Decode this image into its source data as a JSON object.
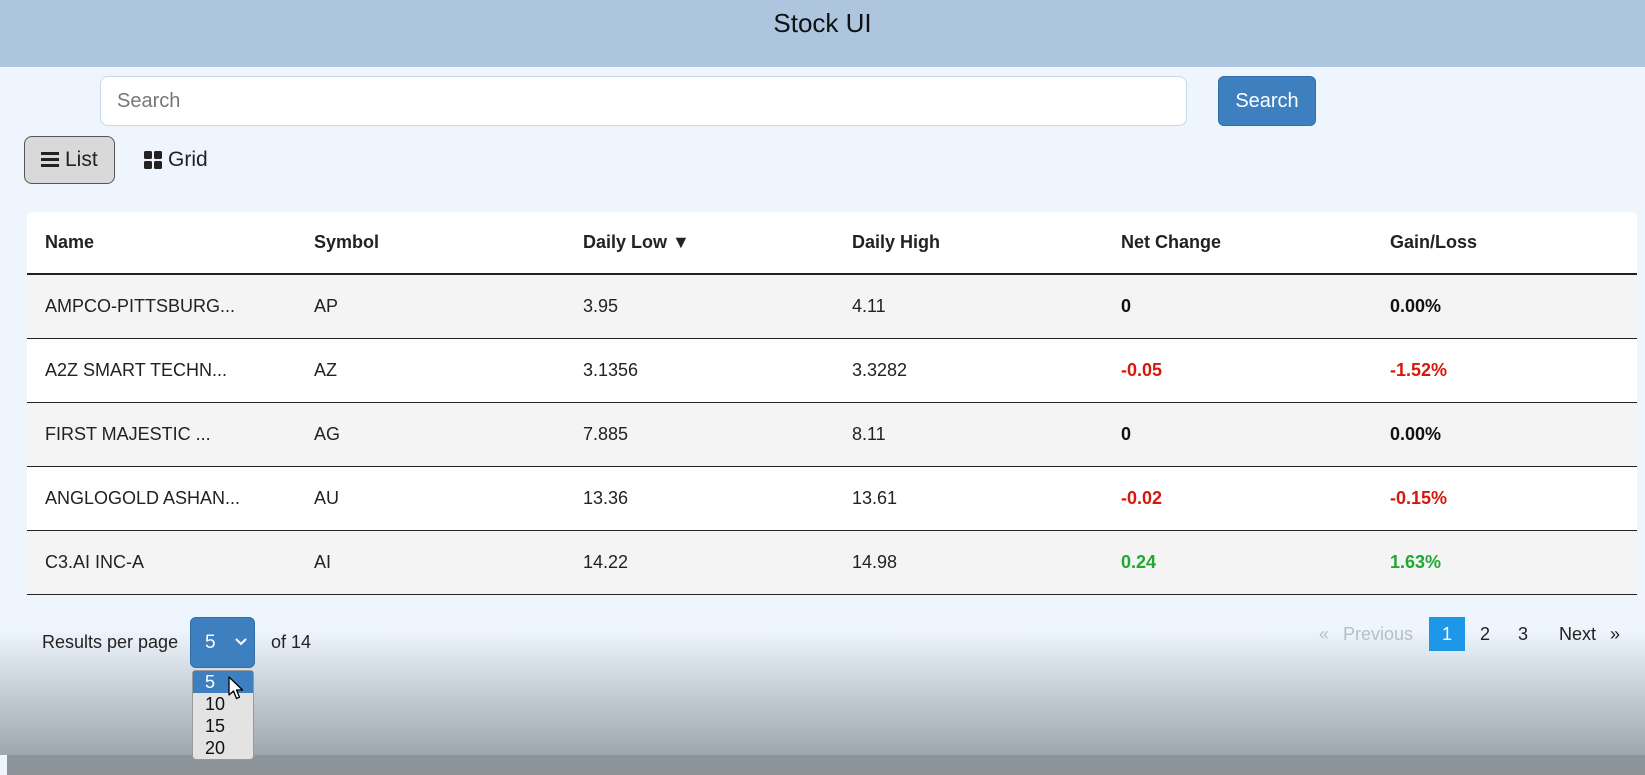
{
  "header": {
    "title": "Stock UI"
  },
  "search": {
    "placeholder": "Search",
    "button_label": "Search"
  },
  "views": {
    "list_label": "List",
    "grid_label": "Grid",
    "active": "List"
  },
  "table": {
    "columns": [
      "Name",
      "Symbol",
      "Daily Low ▼",
      "Daily High",
      "Net Change",
      "Gain/Loss"
    ],
    "rows": [
      {
        "name": "AMPCO-PITTSBURG...",
        "symbol": "AP",
        "low": "3.95",
        "high": "4.11",
        "change": "0",
        "gain": "0.00%",
        "trend": "neutral"
      },
      {
        "name": "A2Z SMART TECHN...",
        "symbol": "AZ",
        "low": "3.1356",
        "high": "3.3282",
        "change": "-0.05",
        "gain": "-1.52%",
        "trend": "negative"
      },
      {
        "name": "FIRST MAJESTIC ...",
        "symbol": "AG",
        "low": "7.885",
        "high": "8.11",
        "change": "0",
        "gain": "0.00%",
        "trend": "neutral"
      },
      {
        "name": "ANGLOGOLD ASHAN...",
        "symbol": "AU",
        "low": "13.36",
        "high": "13.61",
        "change": "-0.02",
        "gain": "-0.15%",
        "trend": "negative"
      },
      {
        "name": "C3.AI INC-A",
        "symbol": "AI",
        "low": "14.22",
        "high": "14.98",
        "change": "0.24",
        "gain": "1.63%",
        "trend": "positive"
      }
    ]
  },
  "results_per_page": {
    "label": "Results per page",
    "selected": "5",
    "of_text": "of 14",
    "options": [
      "5",
      "10",
      "15",
      "20"
    ]
  },
  "pagination": {
    "prev_arrow": "«",
    "previous": "Previous",
    "pages": [
      "1",
      "2",
      "3"
    ],
    "current": "1",
    "next": "Next",
    "next_arrow": "»"
  },
  "colors": {
    "header_bg": "#aec5e0",
    "accent": "#3e7fc0",
    "active_page": "#1f97e8",
    "negative": "#d6170b",
    "positive": "#22a832"
  }
}
